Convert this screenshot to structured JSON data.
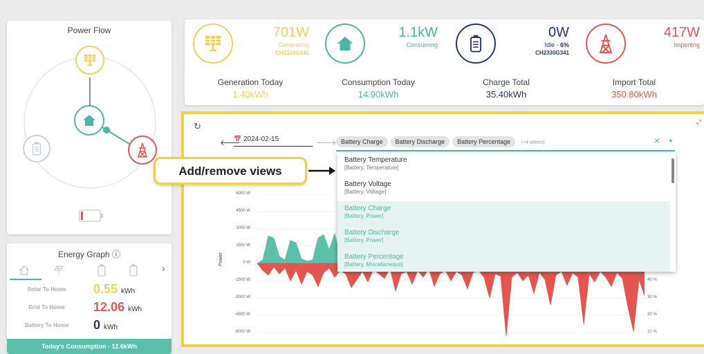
{
  "power_flow": {
    "title": "Power Flow"
  },
  "stats": {
    "solar": {
      "value": "701W",
      "label": "Generating",
      "serial": "CH2330G341"
    },
    "home": {
      "value": "1.1kW",
      "label": "Consuming"
    },
    "battery": {
      "value": "0W",
      "status_prefix": "Idle - ",
      "percent": "6%",
      "serial": "CH2330G341"
    },
    "grid": {
      "value": "417W",
      "label": "Importing"
    }
  },
  "totals": [
    {
      "label": "Generation Today",
      "value": "1.40kWh",
      "color": "#f2cf5b"
    },
    {
      "label": "Consumption Today",
      "value": "14.90kWh",
      "color": "#4cb5a3"
    },
    {
      "label": "Charge Total",
      "value": "35.40kWh",
      "color": "#233a6b"
    },
    {
      "label": "Import Total",
      "value": "350.80kWh",
      "color": "#e5554f"
    }
  ],
  "energy_graph": {
    "title": "Energy Graph",
    "info_icon": "ⓘ",
    "next_icon": "›",
    "rows": [
      {
        "label": "Solar To Home",
        "value": "0.55",
        "unit": "kWh",
        "color": "#f2cf5b"
      },
      {
        "label": "Grid To Home",
        "value": "12.06",
        "unit": "kWh",
        "color": "#e5554f"
      },
      {
        "label": "Battery To Home",
        "value": "0",
        "unit": "kWh",
        "color": "#233a6b"
      }
    ],
    "footer": "Today's Consumption - 12.6kWh"
  },
  "graph_controls": {
    "date": "2024-02-15",
    "tags": [
      "Battery Charge",
      "Battery Discharge",
      "Battery Percentage"
    ],
    "more": "(+4 others)",
    "clear": "×",
    "caret": "▴"
  },
  "dropdown": [
    {
      "title": "Battery Temperature",
      "sub": "[Battery, Temperature]",
      "selected": false
    },
    {
      "title": "Battery Voltage",
      "sub": "[Battery, Voltage]",
      "selected": false
    },
    {
      "title": "Battery Charge",
      "sub": "[Battery, Power]",
      "selected": true
    },
    {
      "title": "Battery Discharge",
      "sub": "[Battery, Power]",
      "selected": true
    },
    {
      "title": "Battery Percentage",
      "sub": "[Battery, Miscellaneous]",
      "selected": true
    }
  ],
  "callout": {
    "text": "Add/remove views"
  },
  "chart_data": {
    "type": "area",
    "ylabel": "Power",
    "y_ticks": [
      "6000 W",
      "4500 W",
      "3000 W",
      "1500 W",
      "0 W",
      "-1500 W",
      "-3000 W",
      "-4500 W",
      "-6000 W"
    ],
    "y2_ticks": [
      "40 %",
      "30 %",
      "20 %",
      "10 %"
    ],
    "ylim": [
      -6000,
      6000
    ],
    "series": [
      {
        "color": "#5bbfa9",
        "values": [
          0,
          300,
          2400,
          2200,
          600,
          300,
          2000,
          1800,
          400,
          200,
          300,
          2200,
          2500,
          1200,
          2600,
          700,
          500,
          1900,
          200,
          300,
          1500,
          300,
          200,
          600,
          800,
          200,
          600,
          300,
          400,
          200,
          300,
          1800,
          300,
          200,
          2600,
          500,
          300,
          200,
          1500,
          300,
          200,
          800,
          200,
          600,
          300,
          200,
          400,
          300,
          200,
          300,
          500,
          200,
          300,
          200,
          400,
          300,
          500,
          200,
          300,
          200,
          400,
          300,
          200,
          300,
          200,
          100,
          200,
          300,
          100,
          200,
          0
        ]
      },
      {
        "color": "#e5554f",
        "values": [
          0,
          -600,
          -1000,
          -300,
          -900,
          -400,
          -1500,
          -600,
          -1800,
          -700,
          -1000,
          -2000,
          -800,
          -400,
          -1200,
          -600,
          -900,
          -2100,
          -1400,
          -700,
          -1600,
          -500,
          -900,
          -1300,
          -400,
          -2400,
          -900,
          -700,
          -1800,
          -600,
          -1200,
          -400,
          -2000,
          -900,
          -600,
          -1500,
          -700,
          -1000,
          -2200,
          -800,
          -600,
          -1200,
          -3000,
          -900,
          -1100,
          -6300,
          -1200,
          -800,
          -1500,
          -1000,
          -2600,
          -800,
          -1400,
          -3600,
          -1000,
          -700,
          -1900,
          -800,
          -1200,
          -5300,
          -900,
          -1600,
          -700,
          -1200,
          -2000,
          -800,
          -1300,
          -3800,
          -5900,
          -1400,
          -2800
        ]
      }
    ]
  }
}
